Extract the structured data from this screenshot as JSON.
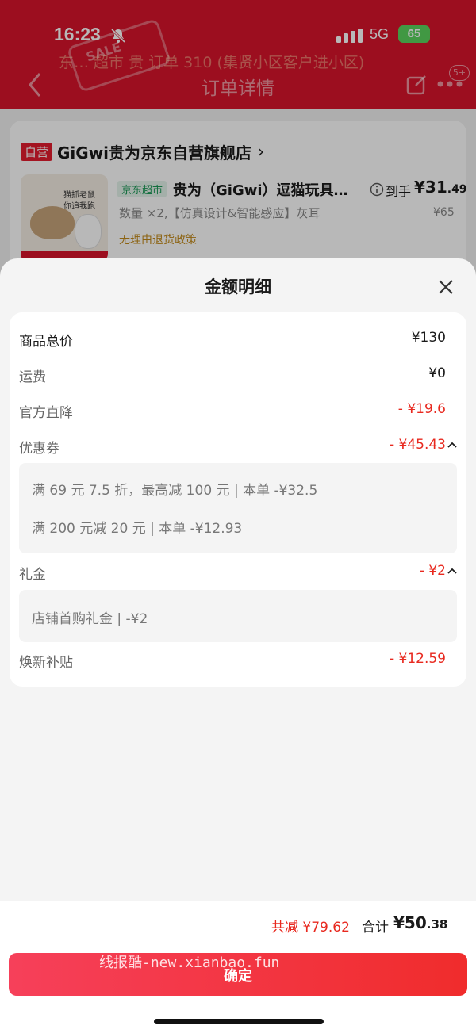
{
  "status_bar": {
    "time": "16:23",
    "network": "5G",
    "battery": "65"
  },
  "background": {
    "header_ghost_text": "东… 超市 贵 订单 310 (集贤小区客户进小区)",
    "decor_text": "SALE",
    "nav_title": "订单详情",
    "nav_badge": "5+",
    "store": {
      "tag": "自营",
      "name": "GiGwi贵为京东自营旗舰店",
      "chevron": "›"
    },
    "product": {
      "image_text": "猫抓老鼠\n你追我跑",
      "channel_tag": "京东超市",
      "title": "贵为（GiGwi）逗猫玩具…",
      "price_label": "到手",
      "price_main": "¥31",
      "price_decimal": ".49",
      "spec": "数量 ×2,【仿真设计&智能感应】灰耳",
      "original_price": "¥65",
      "policy": "无理由退货政策"
    }
  },
  "sheet": {
    "title": "金额明细",
    "rows": {
      "goods_total": {
        "label": "商品总价",
        "value": "¥130"
      },
      "shipping": {
        "label": "运费",
        "value": "¥0"
      },
      "official_discount": {
        "label": "官方直降",
        "value": "- ¥19.6"
      },
      "coupon": {
        "label": "优惠券",
        "value": "- ¥45.43"
      },
      "gift_money": {
        "label": "礼金",
        "value": "- ¥2"
      },
      "trade_in_subsidy": {
        "label": "焕新补贴",
        "value": "- ¥12.59"
      }
    },
    "coupon_details": [
      "满 69 元 7.5 折，最高减 100 元 | 本单 -¥32.5",
      "满 200 元减 20 元 | 本单 -¥12.93"
    ],
    "gift_details": [
      "店铺首购礼金 | -¥2"
    ],
    "footer": {
      "saved": "共减 ¥79.62",
      "total_label": "合计",
      "total_main": "¥50",
      "total_decimal": ".38",
      "confirm_label": "确定",
      "watermark": "线报酷-new.xianbao.fun"
    }
  },
  "colors": {
    "accent_red": "#e8291f",
    "header_red": "#d9142b",
    "jd_green": "#1d9a58"
  }
}
